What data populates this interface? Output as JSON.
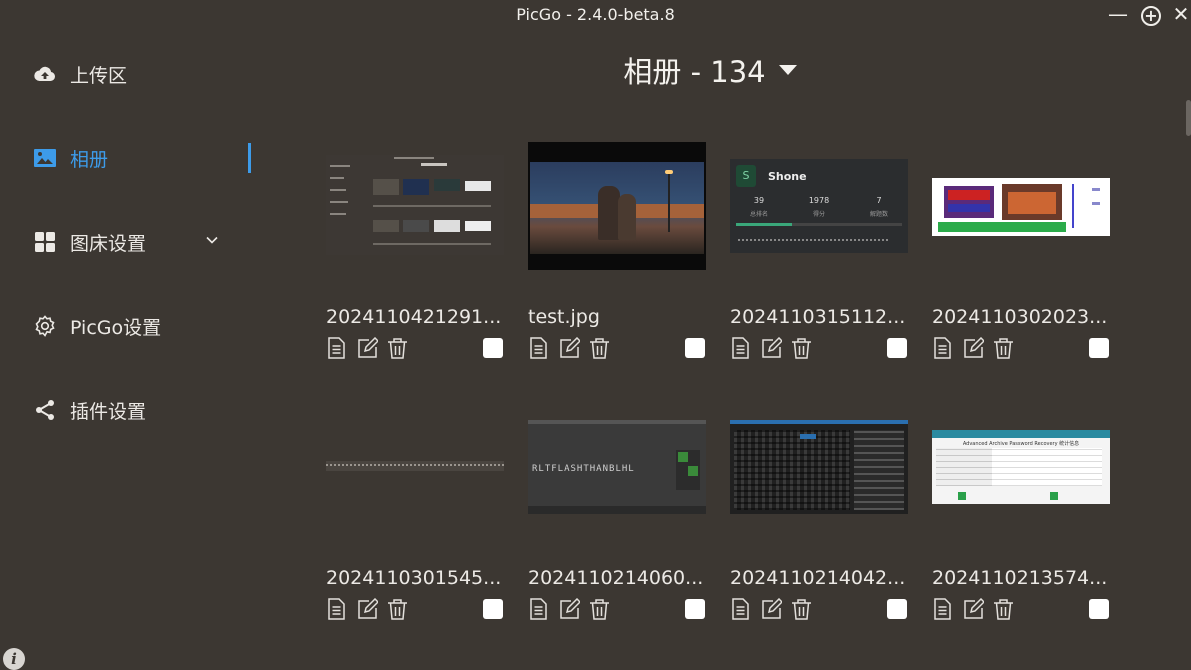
{
  "window": {
    "title": "PicGo - 2.4.0-beta.8"
  },
  "sidebar": {
    "items": [
      {
        "label": "上传区"
      },
      {
        "label": "相册"
      },
      {
        "label": "图床设置"
      },
      {
        "label": "PicGo设置"
      },
      {
        "label": "插件设置"
      }
    ]
  },
  "album": {
    "title": "相册 - 134"
  },
  "thumbs": {
    "shone_card": {
      "initial": "S",
      "name": "Shone",
      "stats": [
        "39",
        "1978",
        "7"
      ],
      "stat_labels": [
        "总排名",
        "得分",
        "解题数"
      ]
    },
    "archive_dialog": {
      "heading": "Advanced Archive Password Recovery 统计信息"
    },
    "sketch_text": "RLTFLASHTHANBLHL"
  },
  "photos": [
    {
      "name": "2024110421291...",
      "thumb": "screenshot"
    },
    {
      "name": "test.jpg",
      "thumb": "anime"
    },
    {
      "name": "2024110315112...",
      "thumb": "shone"
    },
    {
      "name": "2024110302023...",
      "thumb": "pixel"
    },
    {
      "name": "2024110301545...",
      "thumb": "strip"
    },
    {
      "name": "2024110214060...",
      "thumb": "editor"
    },
    {
      "name": "2024110214042...",
      "thumb": "hexeditor"
    },
    {
      "name": "2024110213574...",
      "thumb": "dialog"
    }
  ],
  "colors": {
    "accent": "#3d9be9",
    "background": "#3c3732"
  }
}
